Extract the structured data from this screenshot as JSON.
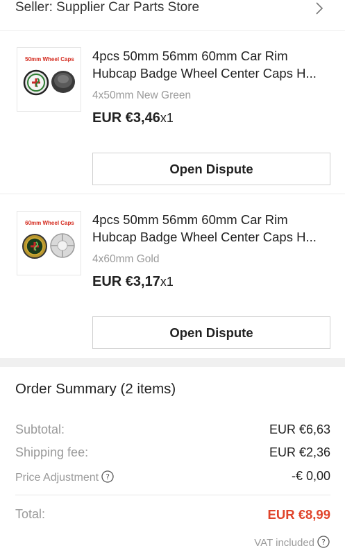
{
  "seller": {
    "label": "Seller: Supplier Car Parts Store",
    "chevron_icon": "chevron-right-icon"
  },
  "items": [
    {
      "thumb_caption": "50mm  Wheel  Caps",
      "title_line1": "4pcs 50mm 56mm 60mm Car Rim",
      "title_line2": "Hubcap Badge Wheel Center Caps H...",
      "variant": "4x50mm New Green",
      "price": "EUR €3,46",
      "quantity": "x1",
      "dispute_label": "Open Dispute"
    },
    {
      "thumb_caption": "60mm  Wheel  Caps",
      "title_line1": "4pcs 50mm 56mm 60mm Car Rim",
      "title_line2": "Hubcap Badge Wheel Center Caps H...",
      "variant": "4x60mm Gold",
      "price": "EUR €3,17",
      "quantity": "x1",
      "dispute_label": "Open Dispute"
    }
  ],
  "summary": {
    "title": "Order Summary (2 items)",
    "subtotal_label": "Subtotal:",
    "subtotal_value": "EUR €6,63",
    "shipping_label": "Shipping fee:",
    "shipping_value": "EUR €2,36",
    "adjust_label": "Price Adjustment",
    "adjust_value": "-€ 0,00",
    "total_label": "Total:",
    "total_value": "EUR €8,99",
    "vat_label": "VAT included"
  },
  "colors": {
    "accent_total": "#e0442b",
    "thumb_caption": "#d42a1e"
  }
}
